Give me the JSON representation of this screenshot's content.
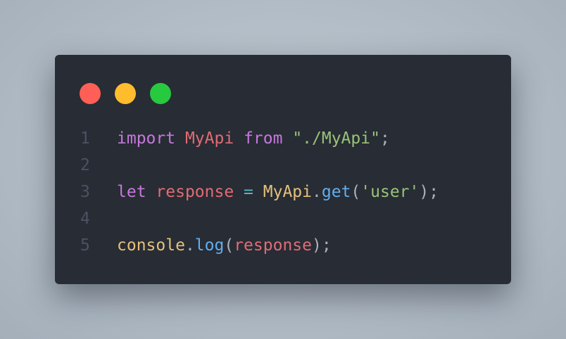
{
  "colors": {
    "background": "#b2bcc6",
    "window_bg": "#282c34",
    "dot_red": "#ff5f56",
    "dot_yellow": "#ffbd2e",
    "dot_green": "#27c93f",
    "line_number": "#4b5263",
    "keyword": "#c678dd",
    "identifier": "#e06c75",
    "string": "#98c379",
    "plain": "#abb2bf",
    "class_name": "#e5c07b",
    "method": "#61afef",
    "operator": "#56b6c2"
  },
  "window_controls": [
    {
      "name": "close",
      "color": "#ff5f56"
    },
    {
      "name": "minimize",
      "color": "#ffbd2e"
    },
    {
      "name": "maximize",
      "color": "#27c93f"
    }
  ],
  "code": {
    "language": "javascript",
    "lines": [
      {
        "number": "1",
        "tokens": [
          {
            "text": "import",
            "type": "keyword"
          },
          {
            "text": " ",
            "type": "plain"
          },
          {
            "text": "MyApi",
            "type": "identifier"
          },
          {
            "text": " ",
            "type": "plain"
          },
          {
            "text": "from",
            "type": "keyword"
          },
          {
            "text": " ",
            "type": "plain"
          },
          {
            "text": "\"./MyApi\"",
            "type": "string"
          },
          {
            "text": ";",
            "type": "plain"
          }
        ]
      },
      {
        "number": "2",
        "tokens": []
      },
      {
        "number": "3",
        "tokens": [
          {
            "text": "let",
            "type": "keyword"
          },
          {
            "text": " ",
            "type": "plain"
          },
          {
            "text": "response",
            "type": "identifier"
          },
          {
            "text": " ",
            "type": "plain"
          },
          {
            "text": "=",
            "type": "operator"
          },
          {
            "text": " ",
            "type": "plain"
          },
          {
            "text": "MyApi",
            "type": "class_name"
          },
          {
            "text": ".",
            "type": "plain"
          },
          {
            "text": "get",
            "type": "method"
          },
          {
            "text": "(",
            "type": "plain"
          },
          {
            "text": "'user'",
            "type": "string"
          },
          {
            "text": ");",
            "type": "plain"
          }
        ]
      },
      {
        "number": "4",
        "tokens": []
      },
      {
        "number": "5",
        "tokens": [
          {
            "text": "console",
            "type": "class_name"
          },
          {
            "text": ".",
            "type": "plain"
          },
          {
            "text": "log",
            "type": "method"
          },
          {
            "text": "(",
            "type": "plain"
          },
          {
            "text": "response",
            "type": "identifier"
          },
          {
            "text": ");",
            "type": "plain"
          }
        ]
      }
    ]
  }
}
